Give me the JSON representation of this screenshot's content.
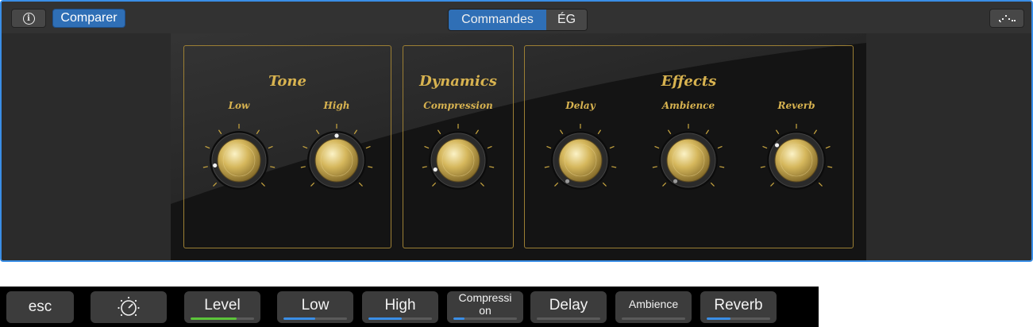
{
  "toolbar": {
    "compare_label": "Comparer",
    "segments": [
      {
        "label": "Commandes",
        "selected": true
      },
      {
        "label": "ÉG",
        "selected": false
      }
    ],
    "info_icon": "info-icon",
    "view_icon": "view-options-icon"
  },
  "colors": {
    "accent": "#2f6fb6",
    "gold": "#d8b350",
    "level_fill": "#5cc53a",
    "slider_fill": "#3a8ee6"
  },
  "sections": {
    "tone": {
      "title": "Tone",
      "knobs": [
        {
          "label": "Low"
        },
        {
          "label": "High"
        }
      ]
    },
    "dynamics": {
      "title": "Dynamics",
      "knobs": [
        {
          "label": "Compression"
        }
      ]
    },
    "effects": {
      "title": "Effects",
      "knobs": [
        {
          "label": "Delay"
        },
        {
          "label": "Ambience"
        },
        {
          "label": "Reverb"
        }
      ]
    }
  },
  "touchbar": {
    "keys": [
      {
        "label": "esc",
        "type": "key"
      },
      {
        "label": "",
        "type": "icon",
        "icon": "smart-controls-icon"
      },
      {
        "label": "Level",
        "type": "slider",
        "value": 0.73,
        "color": "#5cc53a"
      },
      {
        "label": "Low",
        "type": "slider",
        "value": 0.5,
        "color": "#3a8ee6"
      },
      {
        "label": "High",
        "type": "slider",
        "value": 0.52,
        "color": "#3a8ee6"
      },
      {
        "label": "Compressi\non",
        "type": "slider",
        "value": 0.18,
        "color": "#3a8ee6"
      },
      {
        "label": "Delay",
        "type": "slider",
        "value": 0.0,
        "color": "#3a8ee6"
      },
      {
        "label": "Ambience",
        "type": "slider",
        "value": 0.0,
        "color": "#3a8ee6"
      },
      {
        "label": "Reverb",
        "type": "slider",
        "value": 0.37,
        "color": "#3a8ee6"
      }
    ]
  }
}
